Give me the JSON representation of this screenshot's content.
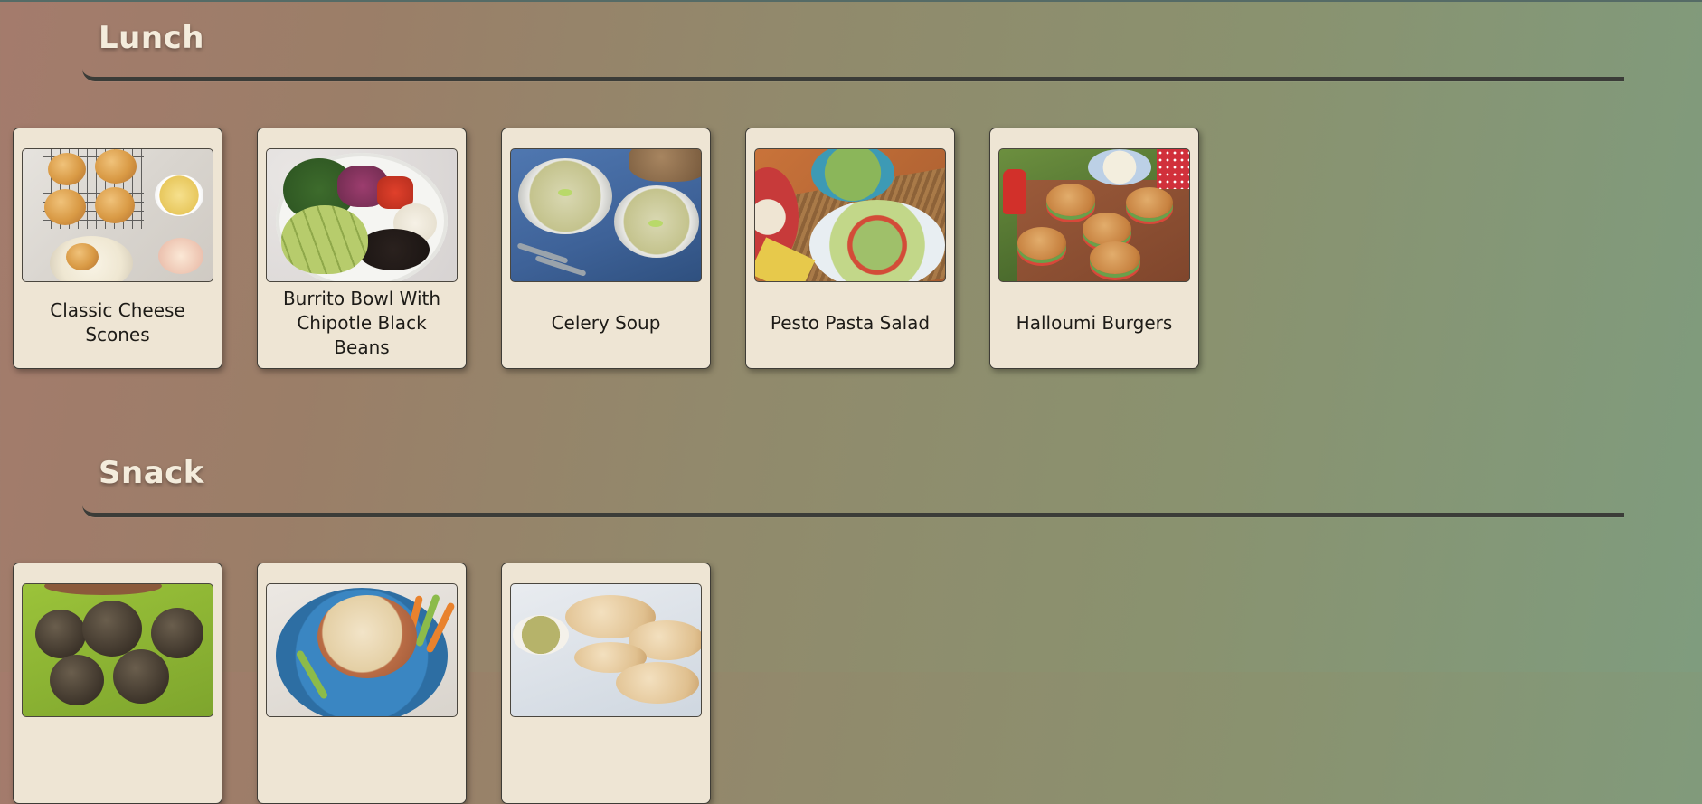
{
  "sections": [
    {
      "title": "Lunch",
      "recipes": [
        {
          "name": "Classic Cheese Scones",
          "image_icon": "scones-photo"
        },
        {
          "name": "Burrito Bowl With Chipotle Black Beans",
          "image_icon": "burrito-bowl-photo"
        },
        {
          "name": "Celery Soup",
          "image_icon": "celery-soup-photo"
        },
        {
          "name": "Pesto Pasta Salad",
          "image_icon": "pasta-salad-photo"
        },
        {
          "name": "Halloumi Burgers",
          "image_icon": "halloumi-burgers-photo"
        }
      ]
    },
    {
      "title": "Snack",
      "recipes": [
        {
          "name": "",
          "image_icon": "falafel-photo"
        },
        {
          "name": "",
          "image_icon": "hummus-photo"
        },
        {
          "name": "",
          "image_icon": "pitta-photo"
        }
      ]
    }
  ],
  "colors": {
    "card_background": "#eee5d4",
    "heading_text": "#f4ecdc",
    "rule": "#3b3c38"
  }
}
